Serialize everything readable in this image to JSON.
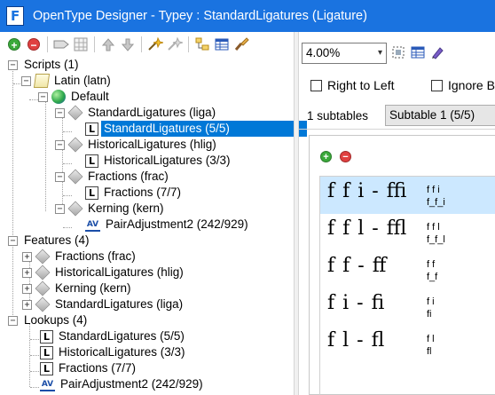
{
  "window": {
    "title": "OpenType Designer - Typey : StandardLigatures (Ligature)"
  },
  "toolbar": {
    "icons": [
      "add-icon",
      "remove-icon",
      "tag-icon",
      "grid-icon",
      "move-up-icon",
      "move-down-icon",
      "wand-icon",
      "wand-alt-icon",
      "tree-icon",
      "table-icon",
      "brush-icon"
    ]
  },
  "tree": {
    "scripts": "Scripts (1)",
    "latin": "Latin (latn)",
    "default": "Default",
    "std_lig_feature": "StandardLigatures (liga)",
    "std_lig_lookup": "StandardLigatures (5/5)",
    "hist_lig_feature": "HistoricalLigatures (hlig)",
    "hist_lig_lookup": "HistoricalLigatures (3/3)",
    "frac_feature": "Fractions (frac)",
    "frac_lookup": "Fractions (7/7)",
    "kern_feature": "Kerning (kern)",
    "pair_lookup": "PairAdjustment2 (242/929)",
    "features": "Features (4)",
    "features_items": [
      "Fractions (frac)",
      "HistoricalLigatures (hlig)",
      "Kerning (kern)",
      "StandardLigatures (liga)"
    ],
    "lookups": "Lookups (4)",
    "lookups_items": [
      "StandardLigatures (5/5)",
      "HistoricalLigatures (3/3)",
      "Fractions (7/7)",
      "PairAdjustment2 (242/929)"
    ]
  },
  "right": {
    "zoom": "4.00%",
    "rtl_label": "Right to Left",
    "ignore_label": "Ignore B",
    "subtables_label": "1 subtables",
    "subtable_selected": "Subtable 1 (5/5)",
    "ligatures": [
      {
        "glyphs": "f f i ‑ ﬃ",
        "seq": "f f i",
        "name": "f_f_i"
      },
      {
        "glyphs": "f f l ‑ ﬄ",
        "seq": "f f l",
        "name": "f_f_l"
      },
      {
        "glyphs": "f f ‑ ﬀ",
        "seq": "f f",
        "name": "f_f"
      },
      {
        "glyphs": "f i ‑ ﬁ",
        "seq": "f i",
        "name": "fi"
      },
      {
        "glyphs": "f l ‑ ﬂ",
        "seq": "f l",
        "name": "fl"
      }
    ]
  },
  "colors": {
    "titlebar": "#1a73e0",
    "selection": "#0078d7",
    "row_highlight": "#cce8ff"
  }
}
